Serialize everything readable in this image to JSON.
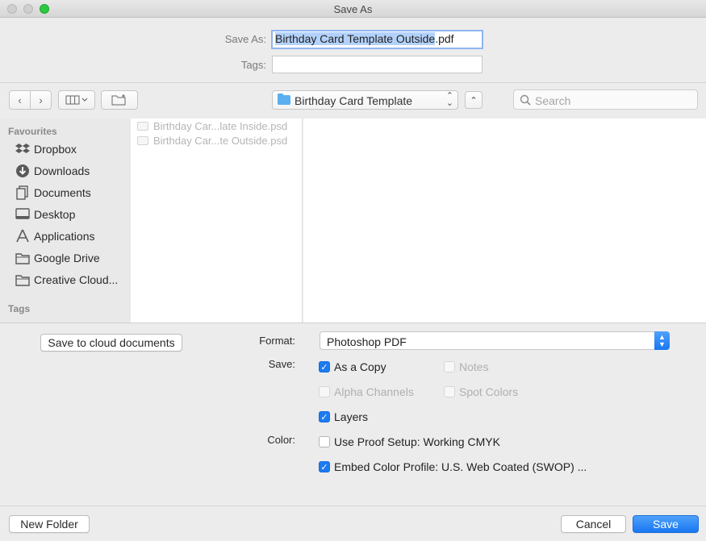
{
  "window": {
    "title": "Save As"
  },
  "name_row": {
    "label": "Save As:",
    "value_selected": "Birthday Card Template Outside",
    "value_ext": ".pdf"
  },
  "tags_row": {
    "label": "Tags:",
    "value": ""
  },
  "toolbar": {
    "location": "Birthday Card Template",
    "search_placeholder": "Search"
  },
  "sidebar": {
    "favourites_header": "Favourites",
    "items": [
      {
        "label": "Dropbox",
        "icon": "dropbox-icon"
      },
      {
        "label": "Downloads",
        "icon": "downloads-icon"
      },
      {
        "label": "Documents",
        "icon": "documents-icon"
      },
      {
        "label": "Desktop",
        "icon": "desktop-icon"
      },
      {
        "label": "Applications",
        "icon": "applications-icon"
      },
      {
        "label": "Google Drive",
        "icon": "folder-icon"
      },
      {
        "label": "Creative Cloud...",
        "icon": "folder-icon"
      }
    ],
    "tags_header": "Tags"
  },
  "files": [
    {
      "name": "Birthday Car...late Inside.psd"
    },
    {
      "name": "Birthday Car...te Outside.psd"
    }
  ],
  "options": {
    "cloud_button": "Save to cloud documents",
    "format_label": "Format:",
    "format_value": "Photoshop PDF",
    "save_label": "Save:",
    "as_copy": "As a Copy",
    "notes": "Notes",
    "alpha_channels": "Alpha Channels",
    "spot_colors": "Spot Colors",
    "layers": "Layers",
    "color_label": "Color:",
    "use_proof_setup": "Use Proof Setup:  Working CMYK",
    "embed_color_profile": "Embed Color Profile:  U.S. Web Coated (SWOP) ..."
  },
  "footer": {
    "new_folder": "New Folder",
    "cancel": "Cancel",
    "save": "Save"
  },
  "colors": {
    "accent": "#1877f2",
    "selection": "#b3d2fb",
    "max_button": "#2bc840"
  }
}
